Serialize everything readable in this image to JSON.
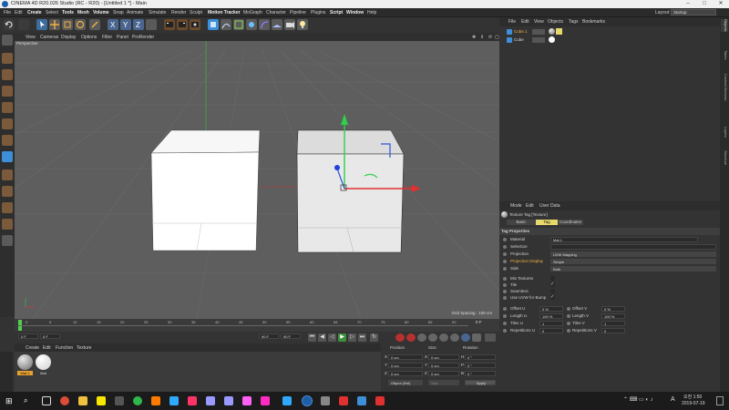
{
  "window": {
    "title": "CINEMA 4D R20.026 Studio (RC - R20) - [Untitled 1 *] - Main",
    "controls": [
      "–",
      "□",
      "✕"
    ]
  },
  "menubar": {
    "items": [
      "File",
      "Edit",
      "Create",
      "Select",
      "Tools",
      "Mesh",
      "Volume",
      "Snap",
      "Animate",
      "Simulate",
      "Render",
      "Sculpt",
      "Motion Tracker",
      "MoGraph",
      "Character",
      "Pipeline",
      "Plugins",
      "Script",
      "Window",
      "Help"
    ],
    "layout_label": "Layout:",
    "layout_value": "Startup"
  },
  "viewport": {
    "menu": [
      "View",
      "Cameras",
      "Display",
      "Options",
      "Filter",
      "Panel",
      "ProRender"
    ],
    "label": "Perspective",
    "grid_info": "Grid Spacing : 100 cm"
  },
  "timeline": {
    "ticks": [
      "0",
      "5",
      "10",
      "15",
      "20",
      "25",
      "30",
      "35",
      "40",
      "45",
      "50",
      "55",
      "60",
      "65",
      "70",
      "75",
      "80",
      "85",
      "90"
    ],
    "frame_end_label": "0 F",
    "start_field": "0 F",
    "start2_field": "0 F",
    "end_field": "90 F",
    "end2_field": "90 F"
  },
  "material_manager": {
    "menu": [
      "Create",
      "Edit",
      "Function",
      "Texture"
    ],
    "materials": [
      {
        "name": "Mat.1",
        "color": "#a0a0a0",
        "selected": true
      },
      {
        "name": "Mat",
        "color": "#ffffff",
        "selected": false
      }
    ]
  },
  "coordinates": {
    "headers": [
      "Position",
      "Size",
      "Rotation"
    ],
    "rows": [
      {
        "axis": "X",
        "pos": "0 cm",
        "size_axis": "X",
        "size": "0 cm",
        "rot_axis": "H",
        "rot": "0 °"
      },
      {
        "axis": "Y",
        "pos": "0 cm",
        "size_axis": "Y",
        "size": "0 cm",
        "rot_axis": "P",
        "rot": "0 °"
      },
      {
        "axis": "Z",
        "pos": "0 cm",
        "size_axis": "Z",
        "size": "0 cm",
        "rot_axis": "B",
        "rot": "0 °"
      }
    ],
    "mode_select": "Object (Rel)",
    "size_select": "Size",
    "apply_label": "Apply"
  },
  "object_manager": {
    "menu": [
      "File",
      "Edit",
      "View",
      "Objects",
      "Tags",
      "Bookmarks"
    ],
    "objects": [
      {
        "name": "Cube.1",
        "selected": true
      },
      {
        "name": "Cube",
        "selected": false
      }
    ]
  },
  "right_tabs": [
    "Objects",
    "Takes",
    "Content Browser",
    "Layers",
    "Structure"
  ],
  "attribute_manager": {
    "menu": [
      "Mode",
      "Edit",
      "User Data"
    ],
    "header": "Texture Tag [Texture]",
    "tabs": [
      "Basic",
      "Tag",
      "Coordinates"
    ],
    "active_tab": "Tag",
    "section": "Tag Properties",
    "material_label": "Material",
    "material_value": "Mat.1",
    "selection_label": "Selection",
    "projection_label": "Projection",
    "projection_value": "UVW Mapping",
    "projection_display_label": "Projection Display",
    "projection_display_value": "Simple",
    "side_label": "Side",
    "side_value": "Both",
    "mix_textures_label": "Mix Textures",
    "tile_label": "Tile",
    "seamless_label": "Seamless",
    "use_uvw_label": "Use UVW for Bump",
    "fields": [
      {
        "label": "Offset U",
        "value": "0 %",
        "label2": "Offset V",
        "value2": "0 %"
      },
      {
        "label": "Length U",
        "value": "100 %",
        "label2": "Length V",
        "value2": "100 %"
      },
      {
        "label": "Tiles U",
        "value": "1",
        "label2": "Tiles V",
        "value2": "1"
      },
      {
        "label": "Repetitions U",
        "value": "0",
        "label2": "Repetitions V",
        "value2": "0"
      }
    ]
  },
  "taskbar": {
    "time": "오전 1:50",
    "date": "2019-07-19",
    "lang": "A"
  },
  "colors": {
    "accent": "#4a8fe0",
    "tab_active": "#e6d86a",
    "viewport_bg": "#5e5e5e"
  }
}
